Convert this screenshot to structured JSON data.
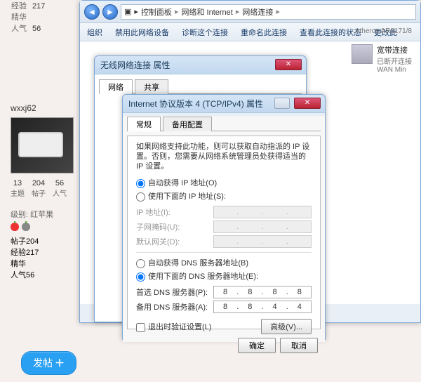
{
  "forum": {
    "stats": [
      {
        "label": "经验",
        "value": "217"
      },
      {
        "label": "精华",
        "value": ""
      },
      {
        "label": "人气",
        "value": "56"
      }
    ],
    "user": {
      "name": "wxxj62",
      "below_stats": [
        {
          "num": "13",
          "label": "主题"
        },
        {
          "num": "204",
          "label": "帖子"
        },
        {
          "num": "56",
          "label": "人气"
        }
      ]
    },
    "level": {
      "title": "级别: 红苹果",
      "rows": [
        {
          "label": "帖子",
          "value": "204"
        },
        {
          "label": "经验",
          "value": "217"
        },
        {
          "label": "精华",
          "value": ""
        },
        {
          "label": "人气",
          "value": "56"
        }
      ]
    },
    "post_button": "发帖"
  },
  "explorer": {
    "breadcrumb": [
      "控制面板",
      "网络和 Internet",
      "网络连接"
    ],
    "toolbar": [
      "组织",
      "禁用此网络设备",
      "诊断这个连接",
      "重命名此连接",
      "查看此连接的状态",
      "更改此"
    ],
    "connection": {
      "name": "宽带连接",
      "status": "已断开连接",
      "device": "WAN Min",
      "other": "Atheros AR8171/8"
    }
  },
  "prop_dialog": {
    "title": "无线网络连接 属性",
    "tabs": [
      "网络",
      "共享"
    ]
  },
  "ipv4_dialog": {
    "title": "Internet 协议版本 4 (TCP/IPv4) 属性",
    "tabs": [
      "常规",
      "备用配置"
    ],
    "desc": "如果网络支持此功能，则可以获取自动指派的 IP 设置。否则，您需要从网络系统管理员处获得适当的 IP 设置。",
    "ip_section": {
      "auto": "自动获得 IP 地址(O)",
      "manual": "使用下面的 IP 地址(S):",
      "ip_label": "IP 地址(I):",
      "mask_label": "子网掩码(U):",
      "gateway_label": "默认网关(D):"
    },
    "dns_section": {
      "auto": "自动获得 DNS 服务器地址(B)",
      "manual": "使用下面的 DNS 服务器地址(E):",
      "primary_label": "首选 DNS 服务器(P):",
      "alt_label": "备用 DNS 服务器(A):",
      "primary": [
        "8",
        "8",
        "8",
        "8"
      ],
      "alt": [
        "8",
        "8",
        "4",
        "4"
      ]
    },
    "exit_validate": "退出时验证设置(L)",
    "advanced": "高级(V)...",
    "ok": "确定",
    "cancel": "取消"
  }
}
